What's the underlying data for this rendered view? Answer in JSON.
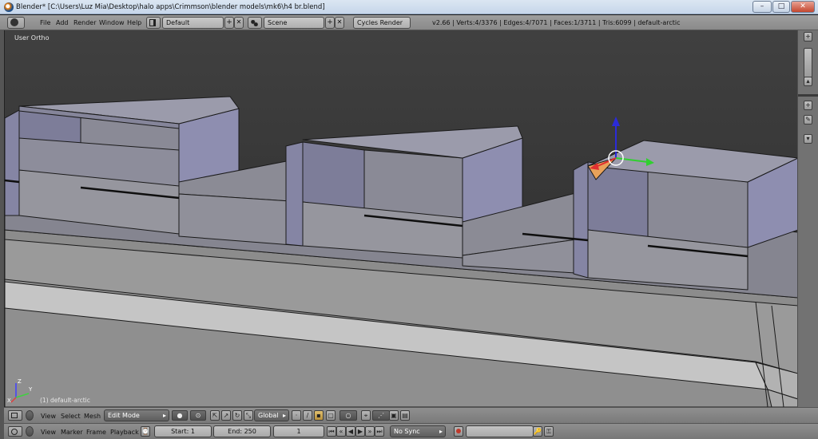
{
  "window": {
    "title": "Blender* [C:\\Users\\Luz Mia\\Desktop\\halo apps\\Crimmson\\blender models\\mk6\\h4 br.blend]",
    "minimize": "–",
    "maximize": "□",
    "close": "✕"
  },
  "info_header": {
    "menus": [
      "File",
      "Add",
      "Render",
      "Window",
      "Help"
    ],
    "screen_layout": "Default",
    "scene": "Scene",
    "render_engine": "Cycles Render",
    "stats": "v2.66 | Verts:4/3376 | Edges:4/7071 | Faces:1/3711 | Tris:6099 | default-arctic"
  },
  "viewport": {
    "view_label": "User Ortho",
    "object_label": "(1) default-arctic",
    "axis_labels": {
      "x": "X",
      "y": "Y",
      "z": "Z"
    },
    "colors": {
      "background": "#393939",
      "face": "#9b9bb3",
      "face_dark": "#7d7d98",
      "face_top": "#9e9eae",
      "selection": "#e8a25a",
      "widget_x": "#e03030",
      "widget_y": "#30d030",
      "widget_z": "#2b2bd8"
    }
  },
  "view3d_header": {
    "menus": [
      "View",
      "Select",
      "Mesh"
    ],
    "mode": "Edit Mode",
    "orientation": "Global"
  },
  "timeline_header": {
    "menus": [
      "View",
      "Marker",
      "Frame",
      "Playback"
    ],
    "start_label": "Start: 1",
    "end_label": "End: 250",
    "current_frame": "1",
    "sync": "No Sync"
  }
}
